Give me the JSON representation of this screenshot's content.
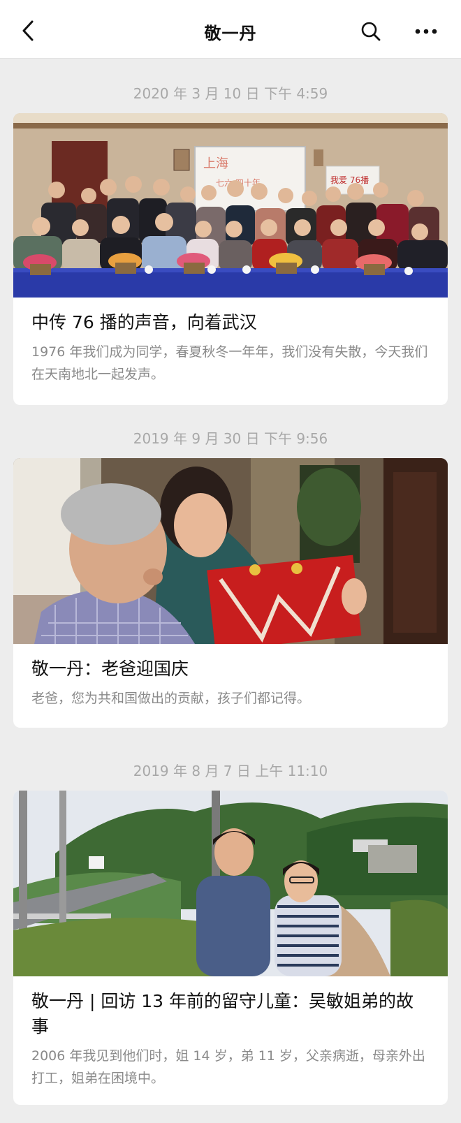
{
  "header": {
    "title": "敬一丹",
    "back_icon": "chevron-left-icon",
    "search_icon": "search-icon",
    "more_icon": "more-dots-icon"
  },
  "articles": [
    {
      "timestamp": "2020 年 3 月 10 日 下午 4:59",
      "title": "中传 76 播的声音，向着武汉",
      "description": "1976 年我们成为同学，春夏秋冬一年年，我们没有失散，今天我们在天南地北一起发声。",
      "image_banner_text": "我爱 76播",
      "image_board_text": "上海 七六 四十年"
    },
    {
      "timestamp": "2019 年 9 月 30 日 下午 9:56",
      "title": "敬一丹：老爸迎国庆",
      "description": "老爸，您为共和国做出的贡献，孩子们都记得。"
    },
    {
      "timestamp": "2019 年 8 月 7 日 上午 11:10",
      "title": "敬一丹 | 回访 13 年前的留守儿童：吴敏姐弟的故事",
      "description": "2006 年我见到他们时，姐 14 岁，弟 11 岁，父亲病逝，母亲外出打工，姐弟在困境中。"
    }
  ],
  "colors": {
    "background": "#ededed",
    "card": "#ffffff",
    "timestamp": "#a8a8a8",
    "title": "#111111",
    "description": "#8a8a8a"
  }
}
